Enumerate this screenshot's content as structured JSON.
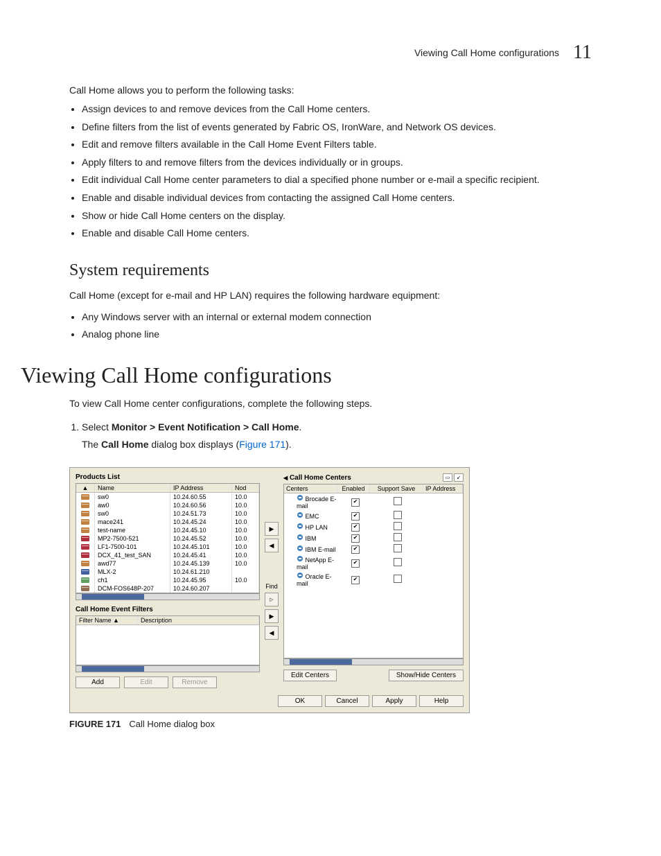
{
  "header": {
    "section": "Viewing Call Home configurations",
    "chapter": "11"
  },
  "intro": "Call Home allows you to perform the following tasks:",
  "tasks": [
    "Assign devices to and remove devices from the Call Home centers.",
    "Define filters from the list of events generated by Fabric  OS, IronWare, and Network OS devices.",
    "Edit and remove filters available in the Call Home Event Filters table.",
    "Apply filters to and remove filters from the devices individually or in groups.",
    "Edit individual Call Home center parameters to dial a specified phone number or e-mail a specific recipient.",
    "Enable and disable individual devices from contacting the assigned Call Home centers.",
    "Show or hide Call Home centers on the display.",
    "Enable and disable Call Home centers."
  ],
  "h2": "System requirements",
  "sysreq_intro": "Call Home (except for e-mail and HP LAN) requires the following hardware equipment:",
  "sysreq": [
    "Any Windows server with an internal or external modem connection",
    "Analog phone line"
  ],
  "h1": "Viewing Call Home configurations",
  "view_intro": "To view Call Home center configurations, complete the following steps.",
  "step1_pre": "Select ",
  "step1_b": "Monitor > Event Notification > Call Home",
  "step1_post": ".",
  "step1_sub_pre": "The ",
  "step1_sub_b": "Call Home",
  "step1_sub_mid": " dialog box displays (",
  "step1_sub_link": "Figure 171",
  "step1_sub_post": ").",
  "dialog": {
    "products_title": "Products List",
    "cols": {
      "name": "Name",
      "ip": "IP Address",
      "nod": "Nod"
    },
    "rows": [
      {
        "ico": "#c08040",
        "name": "sw0",
        "ip": "10.24.60.55",
        "nod": "10.0"
      },
      {
        "ico": "#c08040",
        "name": "aw0",
        "ip": "10.24.60.56",
        "nod": "10.0"
      },
      {
        "ico": "#c08040",
        "name": "sw0",
        "ip": "10.24.51.73",
        "nod": "10.0"
      },
      {
        "ico": "#c08040",
        "name": "mace241",
        "ip": "10.24.45.24",
        "nod": "10.0"
      },
      {
        "ico": "#c08040",
        "name": "test-name",
        "ip": "10.24.45.10",
        "nod": "10.0"
      },
      {
        "ico": "#b03040",
        "name": "MP2-7500-521",
        "ip": "10.24.45.52",
        "nod": "10.0"
      },
      {
        "ico": "#b03040",
        "name": "LF1-7500-101",
        "ip": "10.24.45.101",
        "nod": "10.0"
      },
      {
        "ico": "#b03040",
        "name": "DCX_41_test_SAN",
        "ip": "10.24.45.41",
        "nod": "10.0"
      },
      {
        "ico": "#c08040",
        "name": "awd77",
        "ip": "10.24.45.139",
        "nod": "10.0"
      },
      {
        "ico": "#4060a0",
        "name": "MLX-2",
        "ip": "10.24.61.210",
        "nod": ""
      },
      {
        "ico": "#60a060",
        "name": "ch1",
        "ip": "10.24.45.95",
        "nod": "10.0"
      },
      {
        "ico": "#907050",
        "name": "DCM-FOS648P-207",
        "ip": "10.24.60.207",
        "nod": ""
      }
    ],
    "filters_title": "Call Home Event Filters",
    "f_cols": {
      "n": "Filter Name",
      "d": "Description"
    },
    "btns": {
      "add": "Add",
      "edit": "Edit",
      "remove": "Remove"
    },
    "find": "Find",
    "centers_title": "Call Home Centers",
    "ctr_cols": {
      "c": "Centers",
      "e": "Enabled",
      "s": "Support Save",
      "ip": "IP Address"
    },
    "centers": [
      {
        "name": "Brocade E-mail",
        "en": true,
        "ss": false
      },
      {
        "name": "EMC",
        "en": true,
        "ss": false
      },
      {
        "name": "HP LAN",
        "en": true,
        "ss": false
      },
      {
        "name": "IBM",
        "en": true,
        "ss": false
      },
      {
        "name": "IBM E-mail",
        "en": true,
        "ss": false
      },
      {
        "name": "NetApp E-mail",
        "en": true,
        "ss": false
      },
      {
        "name": "Oracle E-mail",
        "en": true,
        "ss": false
      }
    ],
    "edit_centers": "Edit Centers",
    "show_hide": "Show/Hide Centers",
    "ok": "OK",
    "cancel": "Cancel",
    "apply": "Apply",
    "help": "Help"
  },
  "figure": {
    "num": "FIGURE 171",
    "cap": "Call Home dialog box"
  }
}
